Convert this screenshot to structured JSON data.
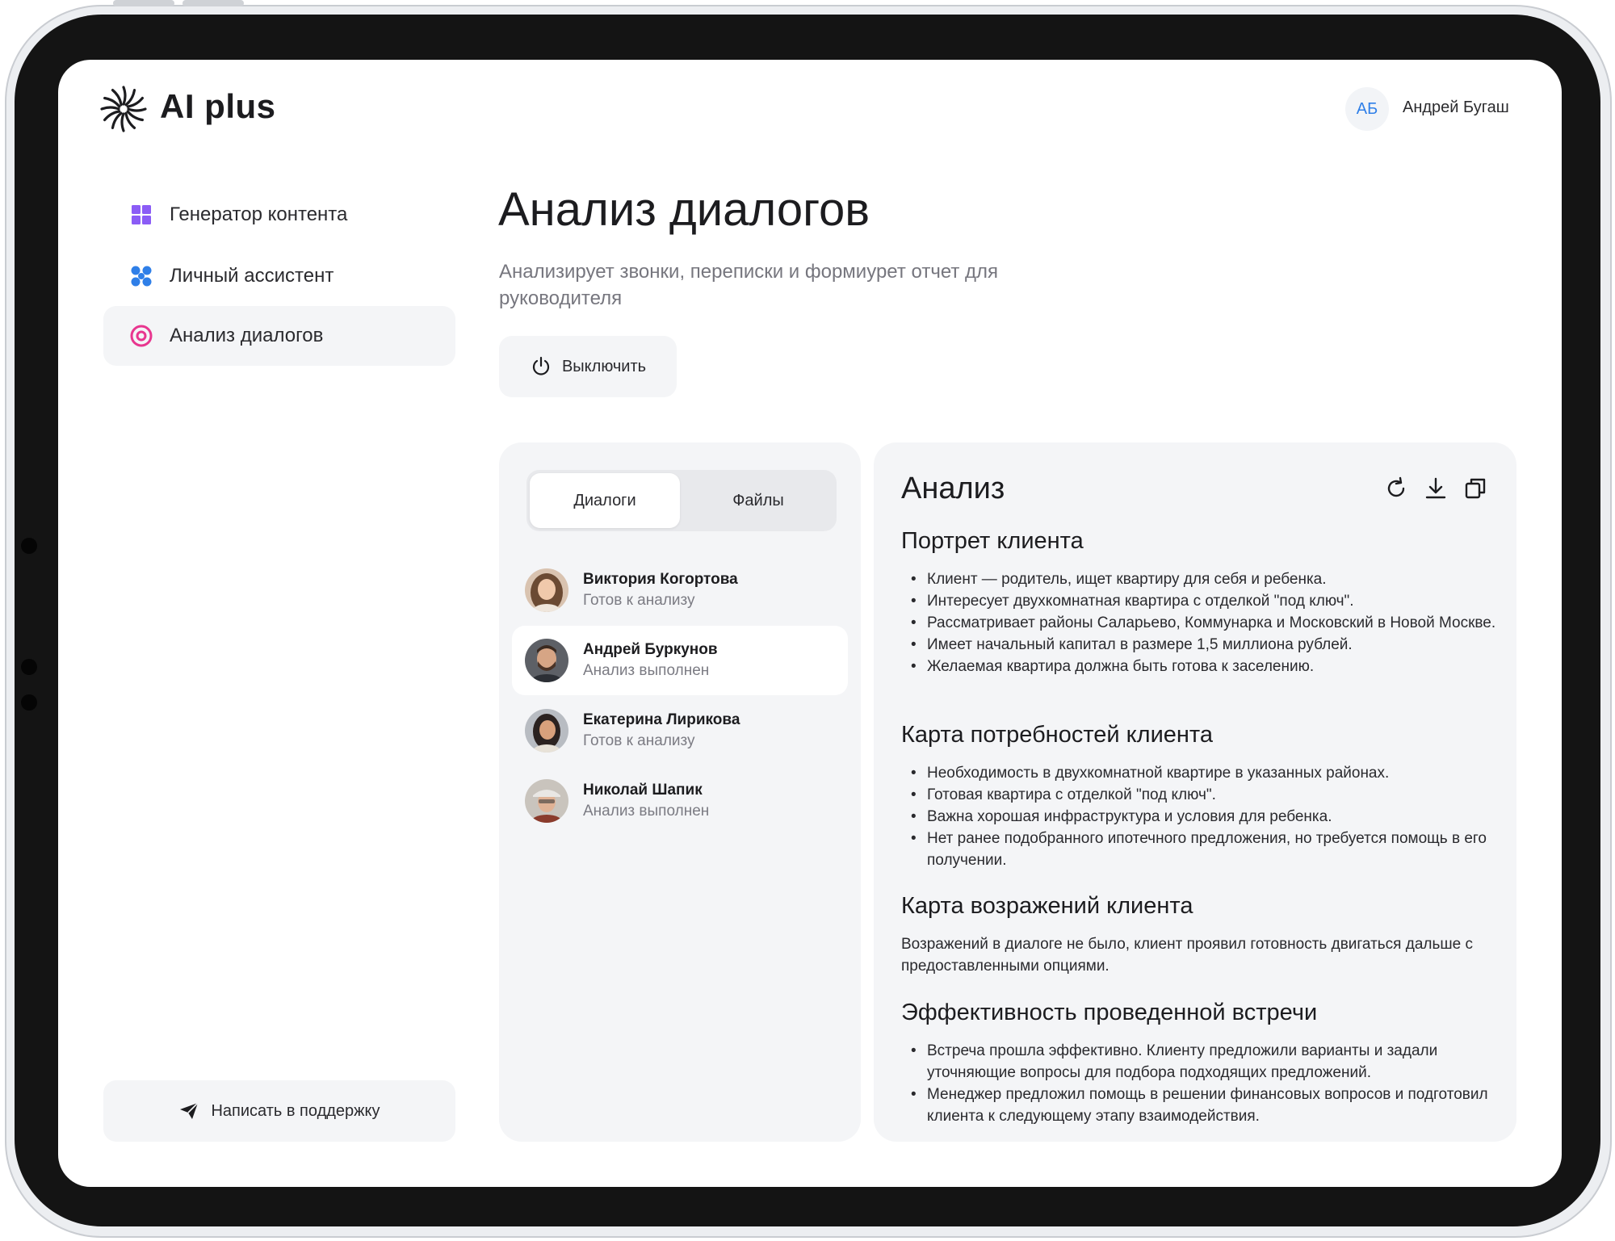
{
  "app": {
    "name": "AI plus"
  },
  "user": {
    "initials": "АБ",
    "name": "Андрей Бугаш"
  },
  "sidebar": {
    "items": [
      {
        "label": "Генератор контента",
        "icon": "grid-icon"
      },
      {
        "label": "Личный ассистент",
        "icon": "dots-cluster-icon"
      },
      {
        "label": "Анализ диалогов",
        "icon": "target-icon",
        "active": true
      }
    ],
    "support_label": "Написать в поддержку"
  },
  "page": {
    "title": "Анализ диалогов",
    "subtitle": "Анализирует звонки, переписки и формиурет отчет для руководителя",
    "off_label": "Выключить"
  },
  "dialogs_panel": {
    "tabs": [
      {
        "label": "Диалоги",
        "active": true
      },
      {
        "label": "Файлы",
        "active": false
      }
    ],
    "contacts": [
      {
        "name": "Виктория Когортова",
        "status": "Готов к анализу"
      },
      {
        "name": "Андрей Буркунов",
        "status": "Анализ выполнен",
        "active": true
      },
      {
        "name": "Екатерина Лирикова",
        "status": "Готов к анализу"
      },
      {
        "name": "Николай Шапик",
        "status": "Анализ выполнен"
      }
    ]
  },
  "analysis": {
    "title": "Анализ",
    "tools": [
      "refresh-icon",
      "download-icon",
      "copy-icon"
    ],
    "sections": {
      "portrait": {
        "heading": "Портрет клиента",
        "items": [
          "Клиент — родитель, ищет квартиру для себя и ребенка.",
          "Интересует двухкомнатная квартира с отделкой \"под ключ\".",
          "Рассматривает районы Саларьево, Коммунарка и Московский в Новой Москве.",
          "Имеет начальный капитал в размере 1,5 миллиона рублей.",
          "Желаемая квартира должна быть готова к заселению."
        ]
      },
      "needs": {
        "heading": "Карта потребностей клиента",
        "items": [
          "Необходимость в двухкомнатной квартире в указанных районах.",
          "Готовая квартира с отделкой \"под ключ\".",
          "Важна хорошая инфраструктура и условия для ребенка.",
          "Нет ранее подобранного ипотечного предложения, но требуется помощь в его получении."
        ]
      },
      "objections": {
        "heading": "Карта возражений клиента",
        "text": "Возражений в диалоге не было, клиент проявил готовность двигаться дальше с предоставленными опциями."
      },
      "efficiency": {
        "heading": "Эффективность проведенной встречи",
        "items": [
          "Встреча прошла эффективно. Клиенту предложили варианты и задали уточняющие вопросы для подбора подходящих предложений.",
          "Менеджер предложил помощь в решении финансовых вопросов и подготовил клиента к следующему этапу взаимодействия."
        ]
      }
    }
  },
  "colors": {
    "accent_blue": "#2f7fe8",
    "grid_purple": "#8b5cf6",
    "target_pink": "#e8368f",
    "panel_bg": "#f4f5f7"
  }
}
